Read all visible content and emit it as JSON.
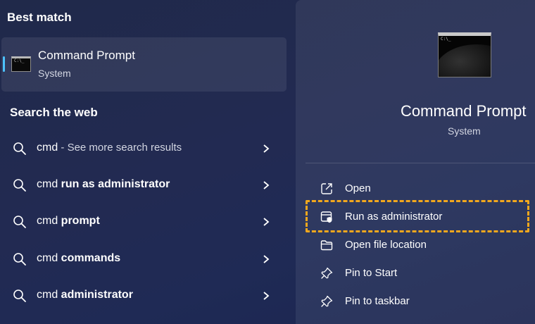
{
  "best_match": {
    "heading": "Best match",
    "title": "Command Prompt",
    "subtitle": "System",
    "icon": "terminal-icon"
  },
  "web": {
    "heading": "Search the web",
    "items": [
      {
        "prefix": "cmd",
        "bold": "",
        "muted": " - See more search results"
      },
      {
        "prefix": "cmd ",
        "bold": "run as administrator",
        "muted": ""
      },
      {
        "prefix": "cmd ",
        "bold": "prompt",
        "muted": ""
      },
      {
        "prefix": "cmd ",
        "bold": "commands",
        "muted": ""
      },
      {
        "prefix": "cmd ",
        "bold": "administrator",
        "muted": ""
      }
    ]
  },
  "details": {
    "title": "Command Prompt",
    "subtitle": "System",
    "icon": "terminal-icon",
    "actions": [
      {
        "label": "Open",
        "icon": "open-external-icon"
      },
      {
        "label": "Run as administrator",
        "icon": "admin-shield-icon"
      },
      {
        "label": "Open file location",
        "icon": "folder-icon"
      },
      {
        "label": "Pin to Start",
        "icon": "pin-icon"
      },
      {
        "label": "Pin to taskbar",
        "icon": "pin-icon"
      }
    ]
  },
  "colors": {
    "accent": "#4cc2ff",
    "highlight": "#f2a81d"
  }
}
